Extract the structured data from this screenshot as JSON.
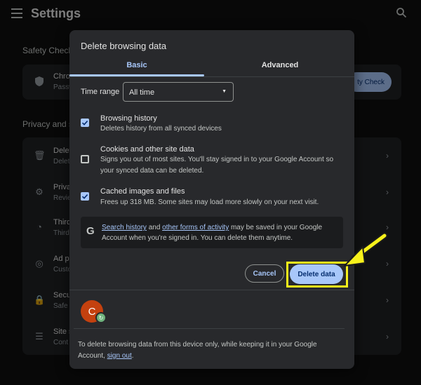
{
  "app": {
    "title": "Settings"
  },
  "background": {
    "safety_section_label": "Safety Check",
    "safety_row": {
      "title": "Chron",
      "subtitle": "Passw"
    },
    "safety_button_label": "ty Check",
    "privacy_section_label": "Privacy and s",
    "privacy_rows": [
      {
        "title": "Delet",
        "subtitle": "Delet"
      },
      {
        "title": "Priva",
        "subtitle": "Revie"
      },
      {
        "title": "Third",
        "subtitle": "Third"
      },
      {
        "title": "Ad p",
        "subtitle": "Custo"
      },
      {
        "title": "Secu",
        "subtitle": "Safe"
      },
      {
        "title": "Site s",
        "subtitle": "Cont"
      }
    ]
  },
  "dialog": {
    "title": "Delete browsing data",
    "tabs": [
      {
        "label": "Basic",
        "selected": true
      },
      {
        "label": "Advanced",
        "selected": false
      }
    ],
    "time_range": {
      "label": "Time range",
      "value": "All time"
    },
    "options": [
      {
        "title": "Browsing history",
        "description": "Deletes history from all synced devices",
        "checked": true
      },
      {
        "title": "Cookies and other site data",
        "description": "Signs you out of most sites. You'll stay signed in to your Google Account so your synced data can be deleted.",
        "checked": false
      },
      {
        "title": "Cached images and files",
        "description": "Frees up 318 MB. Some sites may load more slowly on your next visit.",
        "checked": true
      }
    ],
    "info": {
      "link1": "Search history",
      "and": " and ",
      "link2": "other forms of activity",
      "rest": " may be saved in your Google Account when you're signed in. You can delete them anytime."
    },
    "cancel_label": "Cancel",
    "delete_label": "Delete data",
    "avatar_letter": "C",
    "footer": {
      "text": "To delete browsing data from this device only, while keeping it in your Google Account, ",
      "link": "sign out",
      "end": "."
    }
  },
  "colors": {
    "accent": "#a8c7fa",
    "highlight": "#f7f11b",
    "dialog_bg": "#28292c",
    "avatar": "#c4410f"
  }
}
